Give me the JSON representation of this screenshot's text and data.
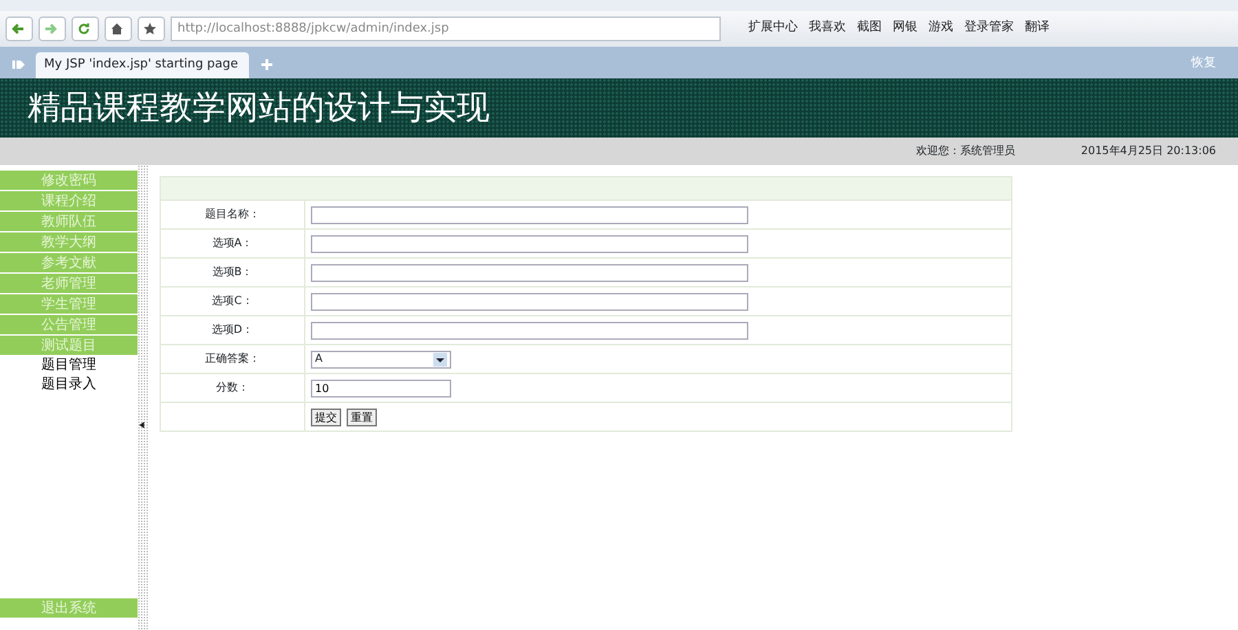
{
  "browser": {
    "address": "http://localhost:8888/jpkcw/admin/index.jsp",
    "extensions": [
      "扩展中心",
      "我喜欢",
      "截图",
      "网银",
      "游戏",
      "登录管家",
      "翻译"
    ],
    "tabs": [
      {
        "label": "My JSP 'index.jsp' starting page",
        "selected": true
      }
    ],
    "restore": "恢复"
  },
  "header": {
    "title": "精品课程教学网站的设计与实现"
  },
  "status": {
    "welcome": "欢迎您：系统管理员",
    "datetime": "2015年4月25日  20:13:06"
  },
  "sidebar": {
    "items": [
      {
        "label": "修改密码",
        "kind": "menu"
      },
      {
        "label": "课程介绍",
        "kind": "menu"
      },
      {
        "label": "教师队伍",
        "kind": "menu"
      },
      {
        "label": "教学大纲",
        "kind": "menu"
      },
      {
        "label": "参考文献",
        "kind": "menu"
      },
      {
        "label": "老师管理",
        "kind": "menu"
      },
      {
        "label": "学生管理",
        "kind": "menu"
      },
      {
        "label": "公告管理",
        "kind": "menu"
      },
      {
        "label": "测试题目",
        "kind": "menu"
      },
      {
        "label": "题目管理",
        "kind": "sub"
      },
      {
        "label": "题目录入",
        "kind": "sub"
      }
    ],
    "logout": "退出系统"
  },
  "form": {
    "fields": [
      {
        "label": "题目名称：",
        "kind": "text"
      },
      {
        "label": "选项A：",
        "kind": "text"
      },
      {
        "label": "选项B：",
        "kind": "text"
      },
      {
        "label": "选项C：",
        "kind": "text"
      },
      {
        "label": "选项D：",
        "kind": "text"
      },
      {
        "label": "正确答案：",
        "kind": "select",
        "value": "A"
      },
      {
        "label": "分数：",
        "kind": "short",
        "value": "10"
      }
    ],
    "buttons": [
      "提交",
      "重置"
    ]
  }
}
